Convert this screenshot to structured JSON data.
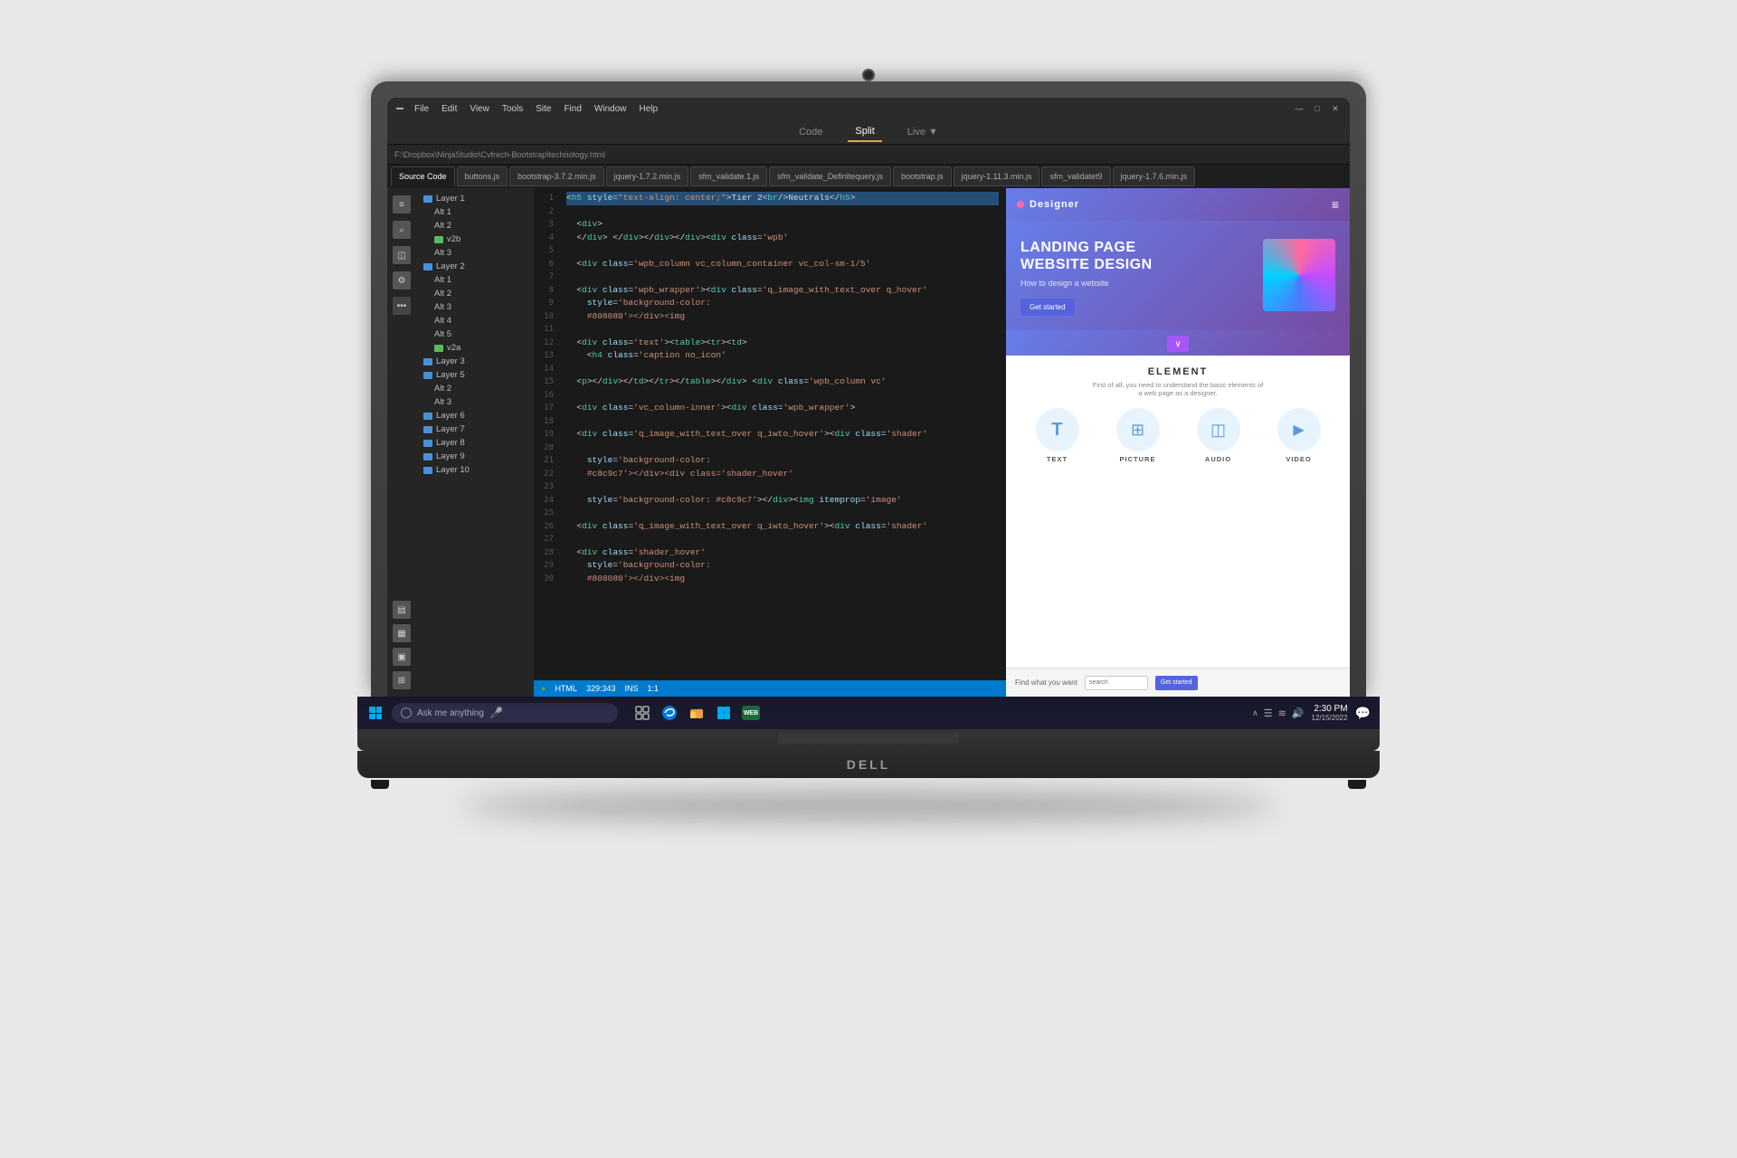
{
  "laptop": {
    "brand": "DELL",
    "camera_alt": "laptop camera"
  },
  "ide": {
    "title_bar": {
      "menu_items": [
        "File",
        "Edit",
        "View",
        "Tools",
        "Site",
        "Find",
        "Window",
        "Help"
      ],
      "filepath": "F:\\Dropbox\\NinjaStudio\\Cvfrech-Bootstrap\\technology.html",
      "win_minimize": "—",
      "win_maximize": "□",
      "win_close": "✕"
    },
    "toolbar": {
      "code_label": "Code",
      "split_label": "Split",
      "live_label": "Live ▼"
    },
    "tabs": [
      "Source Code",
      "buttons.js",
      "bootstrap-3.7.2.min.js",
      "jquery-1.7.2.min.js",
      "sfm_validate.1.js",
      "sfm_validate_Definitequery.js",
      "bootstrap.js",
      "jquery-1.11.3.min.js",
      "sfm_validatet9",
      "jquery-1.7.6.min.js"
    ],
    "code_lines": [
      {
        "n": 1,
        "code": "<h5 style=\"text-align: center;\">Tier 2<br/>Neutrals</h5>"
      },
      {
        "n": 2,
        "code": ""
      },
      {
        "n": 3,
        "code": "  <div>"
      },
      {
        "n": 4,
        "code": "  </div> </div></div></div><div class='wpb'"
      },
      {
        "n": 5,
        "code": ""
      },
      {
        "n": 6,
        "code": "  <div class='wpb_column vc_column_container vc_col-sm-1/5'"
      },
      {
        "n": 7,
        "code": ""
      },
      {
        "n": 8,
        "code": "  <div class='wpb_wrapper'><div class='q_image_with_text_over q_hover'"
      },
      {
        "n": 9,
        "code": "    style='background-color:"
      },
      {
        "n": 10,
        "code": "    #808080'></div><img"
      },
      {
        "n": 11,
        "code": ""
      },
      {
        "n": 12,
        "code": "  <div class='text'><table><tr><td>"
      },
      {
        "n": 13,
        "code": "    <h4 class='caption no_icon'"
      },
      {
        "n": 14,
        "code": ""
      },
      {
        "n": 15,
        "code": "  <p></div></td></tr></table></div> <div class='wpb_column vc'"
      },
      {
        "n": 16,
        "code": ""
      },
      {
        "n": 17,
        "code": "  <div class='vc_column-inner'><div class='wpb_wrapper'>"
      },
      {
        "n": 18,
        "code": ""
      },
      {
        "n": 19,
        "code": "  <div class='q_image_with_text_over q_iwto_hover'><div class='shader'"
      },
      {
        "n": 20,
        "code": ""
      },
      {
        "n": 21,
        "code": "    style='background-color:"
      },
      {
        "n": 22,
        "code": "    #c8c9c7'></div><div class='shader_hover'"
      },
      {
        "n": 23,
        "code": ""
      },
      {
        "n": 24,
        "code": "    style='background-color: #c8c9c7'></div><img itemprop='image'"
      },
      {
        "n": 25,
        "code": ""
      },
      {
        "n": 26,
        "code": "  <div class='q_image_with_text_over q_iwto_hover'><div class='shader'"
      },
      {
        "n": 27,
        "code": ""
      },
      {
        "n": 28,
        "code": "  <div class='shader_hover'"
      },
      {
        "n": 29,
        "code": "    style='background-color:"
      },
      {
        "n": 30,
        "code": "    #808080'></div><img"
      }
    ],
    "status_bar": {
      "indicator": "●",
      "language": "HTML",
      "position": "329:343",
      "mode": "INS",
      "zoom": "1:1"
    },
    "file_tree": {
      "items": [
        {
          "label": "Layer 1",
          "type": "folder",
          "color": "blue",
          "indent": 0
        },
        {
          "label": "Alt 1",
          "type": "file",
          "indent": 1
        },
        {
          "label": "Alt 2",
          "type": "file",
          "indent": 1
        },
        {
          "label": "v2b",
          "type": "folder",
          "color": "green",
          "indent": 1
        },
        {
          "label": "Alt 3",
          "type": "file",
          "indent": 1
        },
        {
          "label": "Layer 2",
          "type": "folder",
          "color": "blue",
          "indent": 0
        },
        {
          "label": "Alt 1",
          "type": "file",
          "indent": 1
        },
        {
          "label": "Alt 2",
          "type": "file",
          "indent": 1
        },
        {
          "label": "Alt 3",
          "type": "file",
          "indent": 1
        },
        {
          "label": "Alt 4",
          "type": "file",
          "indent": 1
        },
        {
          "label": "Alt 5",
          "type": "file",
          "indent": 1
        },
        {
          "label": "v2a",
          "type": "folder",
          "color": "green",
          "indent": 1
        },
        {
          "label": "Layer 3",
          "type": "folder",
          "color": "blue",
          "indent": 0
        },
        {
          "label": "Layer 5",
          "type": "folder",
          "color": "blue",
          "indent": 0
        },
        {
          "label": "Alt 2",
          "type": "file",
          "indent": 1
        },
        {
          "label": "Alt 3",
          "type": "file",
          "indent": 1
        },
        {
          "label": "Layer 6",
          "type": "folder",
          "color": "blue",
          "indent": 0
        },
        {
          "label": "Layer 7",
          "type": "folder",
          "color": "blue",
          "indent": 0
        },
        {
          "label": "Layer 8",
          "type": "folder",
          "color": "blue",
          "indent": 0
        },
        {
          "label": "Layer 9",
          "type": "folder",
          "color": "blue",
          "indent": 0
        },
        {
          "label": "Layer 10",
          "type": "folder",
          "color": "blue",
          "indent": 0
        }
      ]
    }
  },
  "preview": {
    "header": {
      "title": "Designer",
      "menu_icon": "≡"
    },
    "hero": {
      "title_line1": "LANDING PAGE",
      "title_line2": "WEBSITE DESIGN",
      "subtitle": "How to design a website",
      "cta_button": "Get started"
    },
    "section": {
      "title": "ELEMENT",
      "subtitle_line1": "First of all, you need to understand the basic elements of",
      "subtitle_line2": "a web page as a designer.",
      "elements": [
        {
          "label": "TEXT",
          "icon": "T"
        },
        {
          "label": "PICTURE",
          "icon": "⊞"
        },
        {
          "label": "AUDIO",
          "icon": "◫"
        },
        {
          "label": "VIDEO",
          "icon": "▶"
        }
      ]
    },
    "footer": {
      "label": "Find what you want",
      "input_placeholder": "search",
      "button_label": "Get started"
    }
  },
  "taskbar": {
    "search_placeholder": "Ask me anything",
    "time": "2:30 PM",
    "date": "12/15/2022",
    "apps": [
      "edge-browser",
      "file-explorer",
      "windows-store",
      "web-app"
    ]
  }
}
